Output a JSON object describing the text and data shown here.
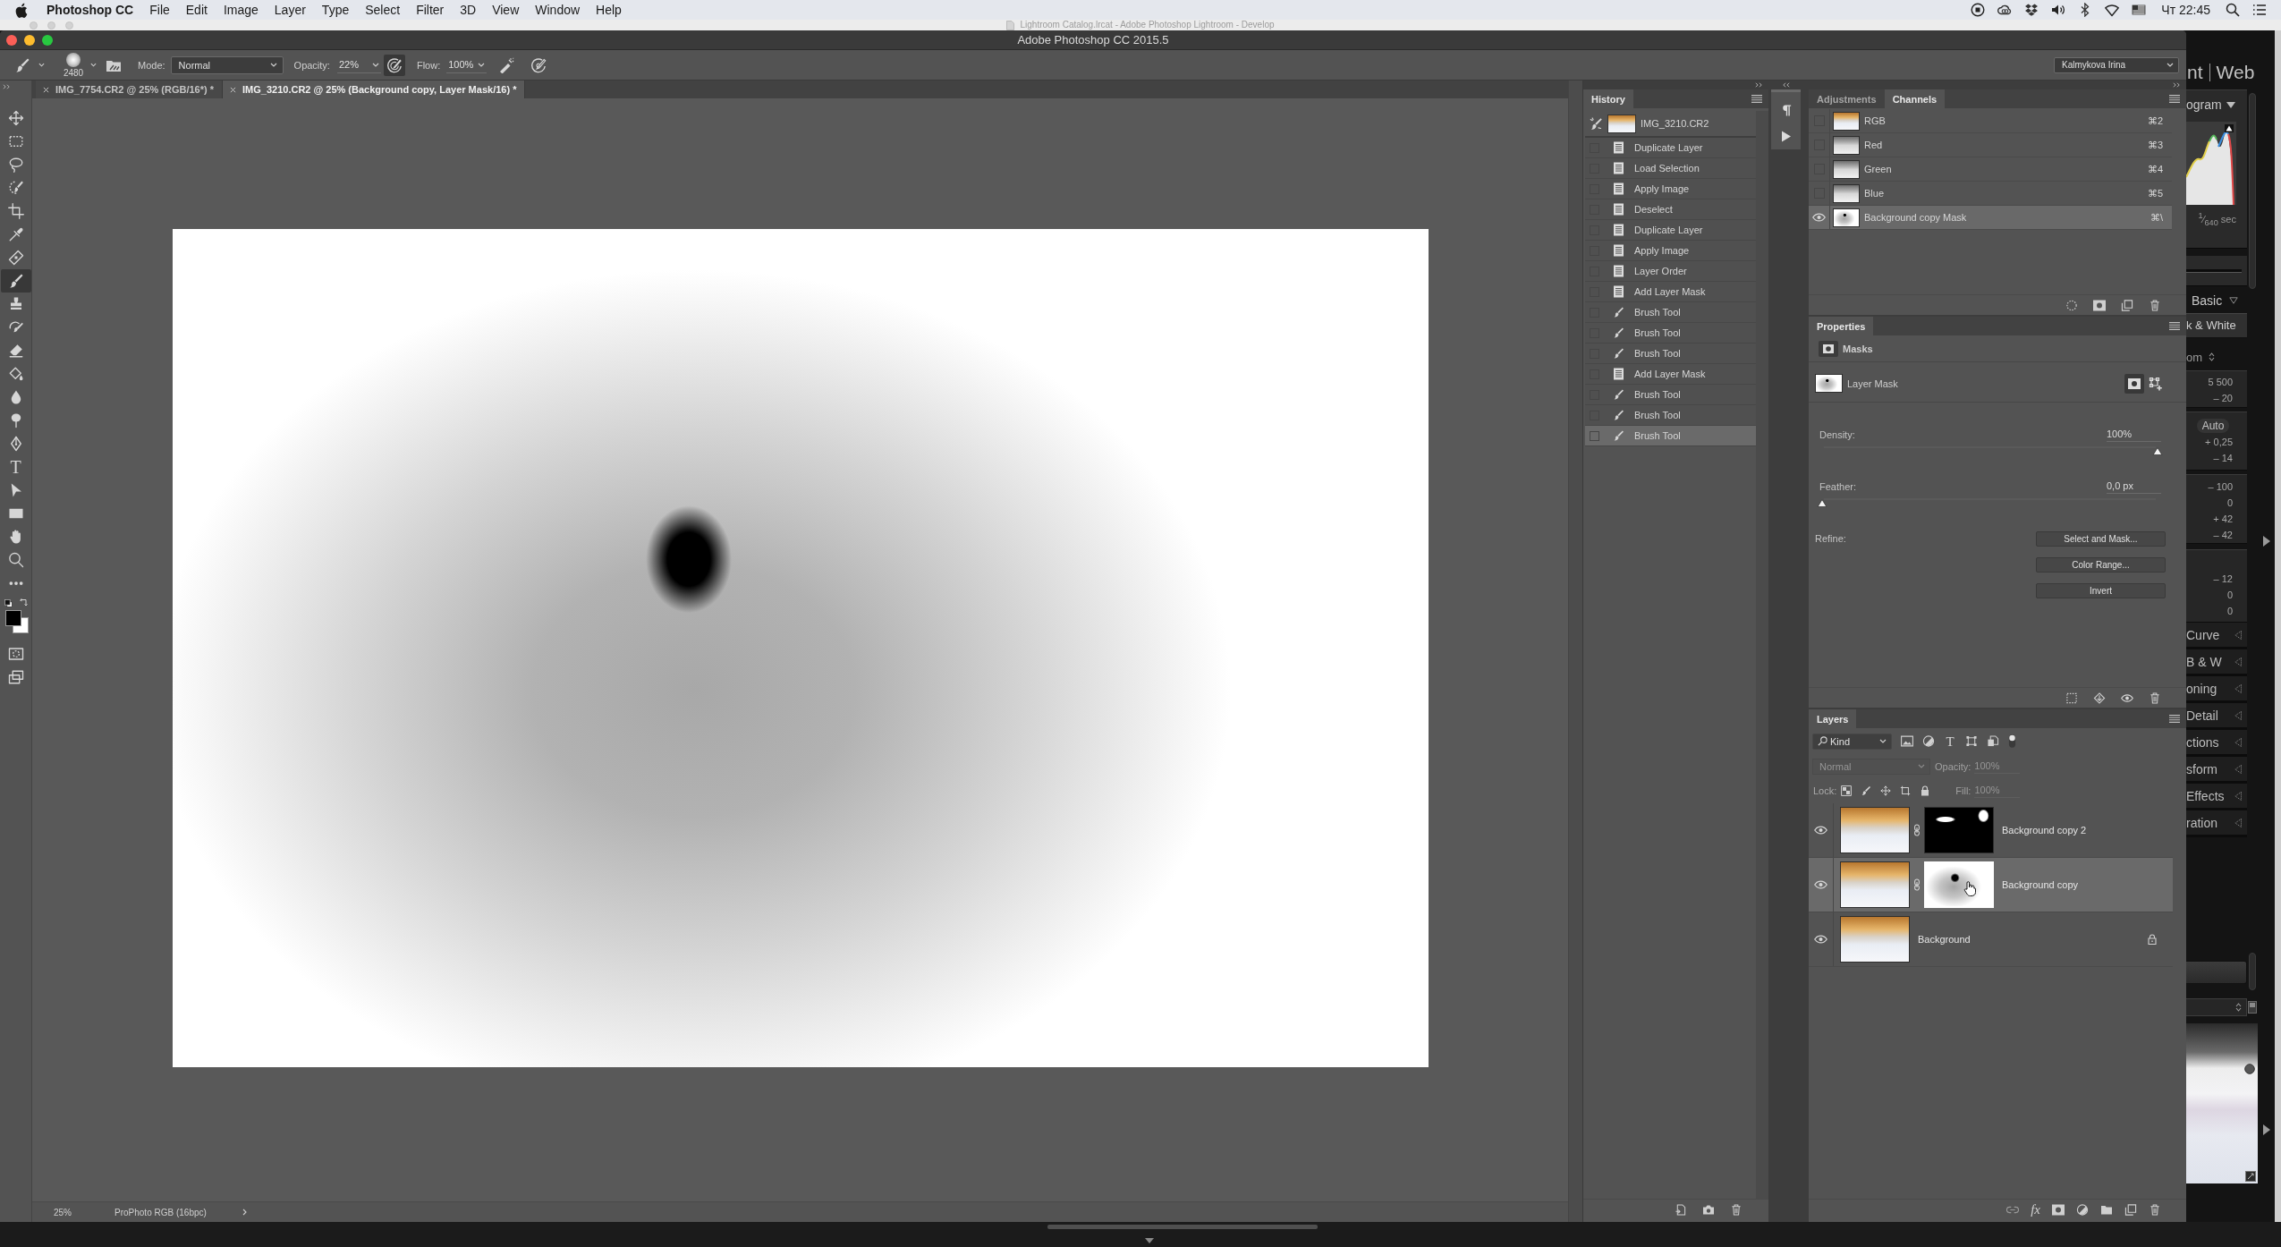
{
  "menubar": {
    "app_name": "Photoshop CC",
    "menus": [
      "File",
      "Edit",
      "Image",
      "Layer",
      "Type",
      "Select",
      "Filter",
      "3D",
      "View",
      "Window",
      "Help"
    ],
    "clock": "Чт 22:45"
  },
  "background_window": {
    "title": "Lightroom Catalog.lrcat - Adobe Photoshop Lightroom - Develop"
  },
  "window": {
    "title": "Adobe Photoshop CC 2015.5"
  },
  "options_bar": {
    "brush_size": "2480",
    "mode_label": "Mode:",
    "mode": "Normal",
    "opacity_label": "Opacity:",
    "opacity": "22%",
    "pressure_opacity_on": true,
    "flow_label": "Flow:",
    "flow": "100%",
    "airbrush_on": false,
    "pressure_size_on": false,
    "workspace": "Kalmykova Irina"
  },
  "document_tabs": [
    {
      "title": "IMG_7754.CR2 @ 25% (RGB/16*) *",
      "selected": false
    },
    {
      "title": "IMG_3210.CR2 @ 25% (Background copy, Layer Mask/16) *",
      "selected": true
    }
  ],
  "tools": [
    {
      "kind": "move",
      "selected": false
    },
    {
      "kind": "marquee",
      "selected": false
    },
    {
      "kind": "lasso",
      "selected": false
    },
    {
      "kind": "quick_selection",
      "selected": false
    },
    {
      "kind": "crop",
      "selected": false
    },
    {
      "kind": "eyedropper",
      "selected": false
    },
    {
      "kind": "healing",
      "selected": false
    },
    {
      "kind": "brush",
      "selected": true
    },
    {
      "kind": "stamp",
      "selected": false
    },
    {
      "kind": "history_brush",
      "selected": false
    },
    {
      "kind": "eraser",
      "selected": false
    },
    {
      "kind": "paint_bucket",
      "selected": false
    },
    {
      "kind": "blur",
      "selected": false
    },
    {
      "kind": "dodge",
      "selected": false
    },
    {
      "kind": "pen",
      "selected": false
    },
    {
      "kind": "type",
      "glyph": "T",
      "selected": false
    },
    {
      "kind": "path_selection",
      "selected": false
    },
    {
      "kind": "rectangle",
      "selected": false
    },
    {
      "kind": "hand",
      "selected": false
    },
    {
      "kind": "zoom",
      "selected": false
    },
    {
      "kind": "more",
      "selected": false
    }
  ],
  "status_bar": {
    "zoom": "25%",
    "profile": "ProPhoto RGB (16bpc)"
  },
  "history": {
    "title": "History",
    "snapshot": "IMG_3210.CR2",
    "states": [
      {
        "label": "Duplicate Layer",
        "kind": "document",
        "selected": false
      },
      {
        "label": "Load Selection",
        "kind": "document",
        "selected": false
      },
      {
        "label": "Apply Image",
        "kind": "document",
        "selected": false
      },
      {
        "label": "Deselect",
        "kind": "document",
        "selected": false
      },
      {
        "label": "Duplicate Layer",
        "kind": "document",
        "selected": false
      },
      {
        "label": "Apply Image",
        "kind": "document",
        "selected": false
      },
      {
        "label": "Layer Order",
        "kind": "document",
        "selected": false
      },
      {
        "label": "Add Layer Mask",
        "kind": "document",
        "selected": false
      },
      {
        "label": "Brush Tool",
        "kind": "brush",
        "selected": false
      },
      {
        "label": "Brush Tool",
        "kind": "brush",
        "selected": false
      },
      {
        "label": "Brush Tool",
        "kind": "brush",
        "selected": false
      },
      {
        "label": "Add Layer Mask",
        "kind": "document",
        "selected": false
      },
      {
        "label": "Brush Tool",
        "kind": "brush",
        "selected": false
      },
      {
        "label": "Brush Tool",
        "kind": "brush",
        "selected": false
      },
      {
        "label": "Brush Tool",
        "kind": "brush",
        "selected": true
      }
    ]
  },
  "channels_panel": {
    "tabs": [
      {
        "label": "Adjustments",
        "selected": false
      },
      {
        "label": "Channels",
        "selected": true
      }
    ],
    "channels": [
      {
        "name": "RGB",
        "shortcut": "⌘2",
        "kind": "composite",
        "visible": false,
        "selected": false
      },
      {
        "name": "Red",
        "shortcut": "⌘3",
        "kind": "color",
        "visible": false,
        "selected": false
      },
      {
        "name": "Green",
        "shortcut": "⌘4",
        "kind": "color",
        "visible": false,
        "selected": false
      },
      {
        "name": "Blue",
        "shortcut": "⌘5",
        "kind": "color",
        "visible": false,
        "selected": false
      },
      {
        "name": "Background copy Mask",
        "shortcut": "⌘\\",
        "kind": "mask",
        "visible": true,
        "selected": true
      }
    ]
  },
  "properties": {
    "title": "Properties",
    "section": "Masks",
    "mask_name": "Layer Mask",
    "mask_types": [
      {
        "kind": "pixel",
        "selected": true
      },
      {
        "kind": "vector",
        "selected": false
      }
    ],
    "sliders": [
      {
        "label": "Density:",
        "value": "100%",
        "level": 1
      },
      {
        "label": "Feather:",
        "value": "0,0 px",
        "level": 0
      }
    ],
    "refine_label": "Refine:",
    "buttons": [
      "Select and Mask...",
      "Color Range...",
      "Invert"
    ]
  },
  "layers_panel": {
    "title": "Layers",
    "filter": "Kind",
    "type_filter": "T",
    "blend_mode": "Normal",
    "opacity_label": "Opacity:",
    "opacity": "100%",
    "lock_label": "Lock:",
    "fill_label": "Fill:",
    "fill": "100%",
    "controls_disabled": true,
    "effects_button": "fx",
    "layers": [
      {
        "name": "Background copy 2",
        "visible": true,
        "selected": false,
        "mask": {
          "kind": "strokes"
        },
        "locked": false
      },
      {
        "name": "Background copy",
        "visible": true,
        "selected": true,
        "mask": {
          "kind": "radial"
        },
        "locked": false
      },
      {
        "name": "Background",
        "visible": true,
        "selected": false,
        "locked": true
      }
    ]
  },
  "lightroom_panel": {
    "modules": [
      "nt",
      "Web"
    ],
    "histogram_title": "ogram",
    "shutter": "$^{1}$⁄$_{640}$ sec",
    "basic_title": "Basic",
    "treatment": "k & White",
    "profile": "om",
    "sections": [
      {
        "values": [
          "5 500",
          "– 20"
        ]
      },
      {
        "button": "Auto",
        "values": [
          "+ 0,25",
          "– 14"
        ]
      },
      {
        "values": [
          "– 100",
          "0",
          "+ 42",
          "– 42"
        ]
      },
      {
        "values": [
          "– 12",
          "0",
          "0"
        ]
      }
    ],
    "collapsed_panels": [
      "Curve",
      "B & W",
      "oning",
      "Detail",
      "ctions",
      "sform",
      "Effects",
      "ration"
    ]
  }
}
